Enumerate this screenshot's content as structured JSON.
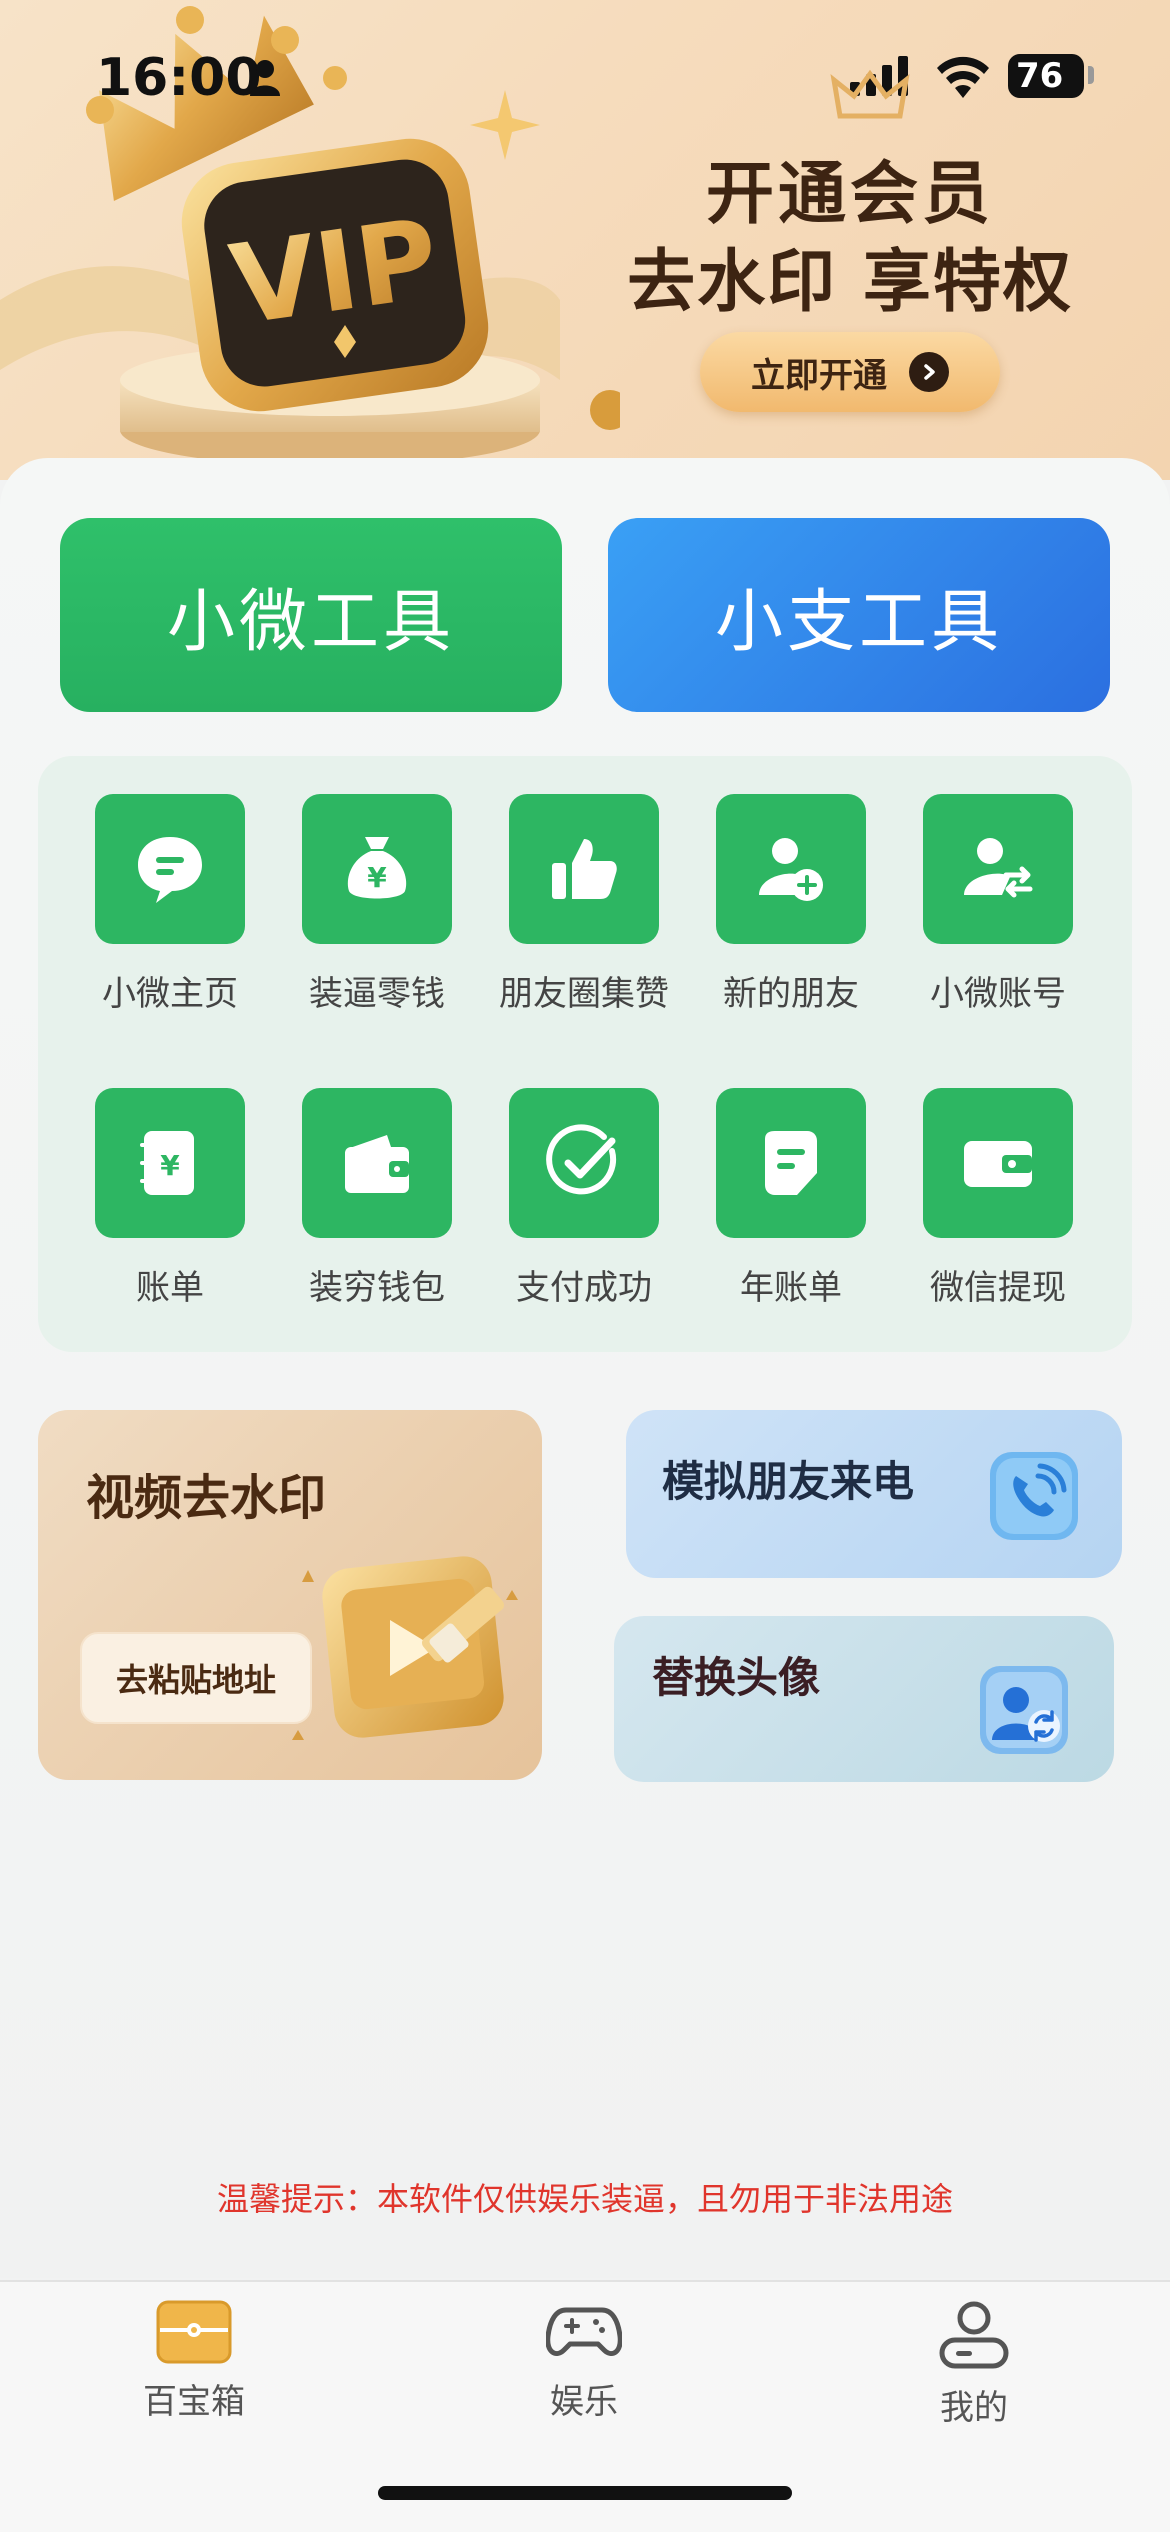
{
  "status_bar": {
    "time": "16:00",
    "battery": "76"
  },
  "banner": {
    "vip_text": "VIP",
    "title": "开通会员",
    "subtitle": "去水印 享特权",
    "button_label": "立即开通"
  },
  "tools": {
    "wx_label": "小微工具",
    "zfb_label": "小支工具"
  },
  "grid": {
    "items": [
      {
        "label": "小微主页",
        "icon": "chat-bubble-icon"
      },
      {
        "label": "装逼零钱",
        "icon": "money-bag-icon"
      },
      {
        "label": "朋友圈集赞",
        "icon": "thumbs-up-icon"
      },
      {
        "label": "新的朋友",
        "icon": "add-user-icon"
      },
      {
        "label": "小微账号",
        "icon": "user-switch-icon"
      },
      {
        "label": "账单",
        "icon": "bill-icon"
      },
      {
        "label": "装穷钱包",
        "icon": "wallet-icon"
      },
      {
        "label": "支付成功",
        "icon": "check-circle-icon"
      },
      {
        "label": "年账单",
        "icon": "document-icon"
      },
      {
        "label": "微信提现",
        "icon": "withdraw-wallet-icon"
      }
    ]
  },
  "features": {
    "video": {
      "title": "视频去水印",
      "button": "去粘贴地址"
    },
    "call": {
      "title": "模拟朋友来电"
    },
    "avatar": {
      "title": "替换头像"
    }
  },
  "warning": "温馨提示：本软件仅供娱乐装逼，且勿用于非法用途",
  "tabbar": {
    "tabs": [
      {
        "label": "百宝箱",
        "icon": "treasure-box-icon",
        "active": true
      },
      {
        "label": "娱乐",
        "icon": "gamepad-icon",
        "active": false
      },
      {
        "label": "我的",
        "icon": "profile-icon",
        "active": false
      }
    ]
  },
  "colors": {
    "green": "#2db662",
    "blue": "#2b6fe0",
    "warning_red": "#e0352c",
    "banner_bg": "#f6dcbd"
  }
}
